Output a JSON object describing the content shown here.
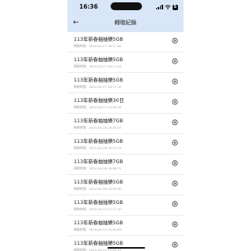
{
  "status_bar": {
    "time": "16:36",
    "battery": "5"
  },
  "header": {
    "title": "轉贈紀錄"
  },
  "records": [
    {
      "title": "113年新春抽抽樂5GB",
      "detail": "轉贈時間：2024-04-27 16:17:00"
    },
    {
      "title": "113年新春抽抽樂5GB",
      "detail": "轉贈時間：2024-04-27 16:17:04"
    },
    {
      "title": "113年新春抽抽樂5GB",
      "detail": "轉贈時間：2024-04-27 16:17:10"
    },
    {
      "title": "113年新春抽抽樂30日",
      "detail": "轉贈時間：2024-04-27 15:58:44"
    },
    {
      "title": "113年新春抽抽樂7GB",
      "detail": "轉贈時間：2024-04-26 20:18:25"
    },
    {
      "title": "113年新春抽抽樂5GB",
      "detail": "轉贈時間：2024-04-26 18:14:25"
    },
    {
      "title": "113年新春抽抽樂7GB",
      "detail": "轉贈時間：2024-04-26 18:06:31"
    },
    {
      "title": "113年新春抽抽樂5GB",
      "detail": "轉贈時間：2024-04-26 18:05:00"
    },
    {
      "title": "113年新春抽抽樂5GB",
      "detail": "轉贈時間：2024-04-25 22:21:20"
    },
    {
      "title": "113年新春抽抽樂5GB",
      "detail": "轉贈時間：2024-04-25 15:04:09"
    },
    {
      "title": "113年新春抽抽樂5GB",
      "detail": "轉贈時間：2024-04-24 20:05:29"
    }
  ]
}
